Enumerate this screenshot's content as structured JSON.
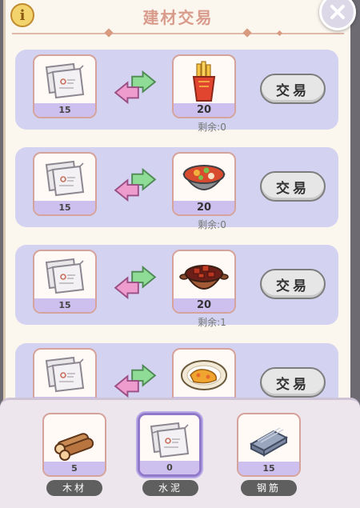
{
  "header": {
    "title": "建材交易",
    "info_icon": "info-icon",
    "close_icon": "close-icon"
  },
  "colors": {
    "row_bg": "#d3d3f1",
    "qty_strip": "#cec0ee",
    "title": "#d89b8c",
    "arrow_green": "#7fd38b",
    "arrow_pink": "#e98bc8"
  },
  "trades": [
    {
      "give": {
        "icon": "cement-bag-icon",
        "qty": "15"
      },
      "get": {
        "icon": "french-fries-icon",
        "qty": "20"
      },
      "remaining": "剩余:0",
      "button": "交易"
    },
    {
      "give": {
        "icon": "cement-bag-icon",
        "qty": "15"
      },
      "get": {
        "icon": "vegetable-stew-bowl-icon",
        "qty": "20"
      },
      "remaining": "剩余:0",
      "button": "交易"
    },
    {
      "give": {
        "icon": "cement-bag-icon",
        "qty": "15"
      },
      "get": {
        "icon": "braised-meat-pot-icon",
        "qty": "20"
      },
      "remaining": "剩余:1",
      "button": "交易"
    },
    {
      "give": {
        "icon": "cement-bag-icon",
        "qty": ""
      },
      "get": {
        "icon": "curry-rice-plate-icon",
        "qty": ""
      },
      "remaining": "",
      "button": "交易"
    }
  ],
  "materials": [
    {
      "name": "木材",
      "qty": "5",
      "icon": "wood-logs-icon",
      "selected": false
    },
    {
      "name": "水泥",
      "qty": "0",
      "icon": "cement-bag-icon",
      "selected": true
    },
    {
      "name": "钢筋",
      "qty": "15",
      "icon": "steel-bars-icon",
      "selected": false
    }
  ]
}
